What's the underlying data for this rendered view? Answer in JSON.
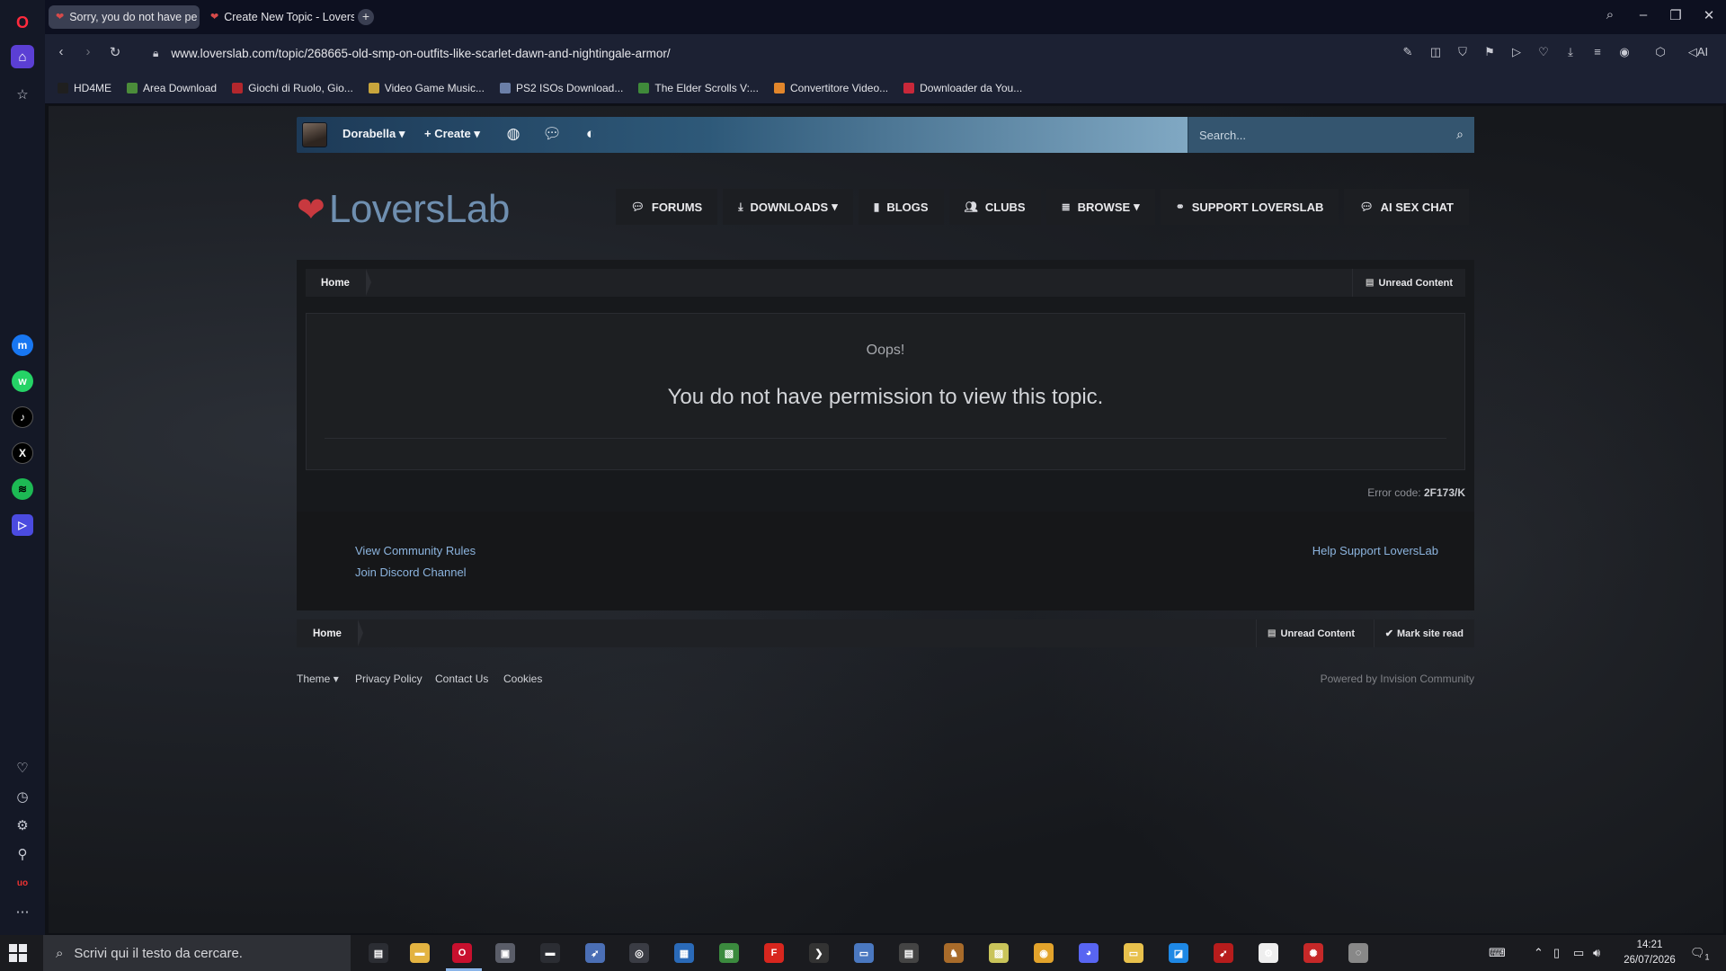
{
  "browser": {
    "tabs": [
      {
        "title": "Sorry, you do not have pe",
        "active": true
      },
      {
        "title": "Create New Topic - Lovers",
        "active": false
      }
    ],
    "url": "www.loverslab.com/topic/268665-old-smp-on-outfits-like-scarlet-dawn-and-nightingale-armor/",
    "bookmarks": [
      {
        "label": "HD4ME",
        "color": "#1f1f1f"
      },
      {
        "label": "Area Download",
        "color": "#4b8c3a"
      },
      {
        "label": "Giochi di Ruolo, Gio...",
        "color": "#b3272d"
      },
      {
        "label": "Video Game Music...",
        "color": "#c8a53c"
      },
      {
        "label": "PS2 ISOs Download...",
        "color": "#6b7fa8"
      },
      {
        "label": "The Elder Scrolls V:...",
        "color": "#3f8a3a"
      },
      {
        "label": "Convertitore Video...",
        "color": "#e2862b"
      },
      {
        "label": "Downloader da You...",
        "color": "#c8283a"
      }
    ],
    "address_icons": [
      "edit-icon",
      "camera-icon",
      "shield-icon",
      "vpn-icon",
      "play-icon",
      "heart-icon",
      "download-icon",
      "menu-icon",
      "profile-icon",
      "cube-icon"
    ],
    "ai_label": "AI"
  },
  "sidebar": {
    "top_icons": [
      "home-icon",
      "star-icon"
    ],
    "apps": [
      "messenger-icon",
      "whatsapp-icon",
      "tiktok-icon",
      "x-icon",
      "spotify-icon",
      "player-icon"
    ],
    "bottom_icons": [
      "heart-icon",
      "history-icon",
      "settings-icon",
      "lightbulb-icon",
      "ublock-icon",
      "more-icon"
    ]
  },
  "site": {
    "userbar": {
      "username": "Dorabella",
      "create": "Create",
      "search_placeholder": "Search..."
    },
    "logo": {
      "text": "LoversLab"
    },
    "nav": [
      {
        "label": "FORUMS",
        "icon": "chat-icon",
        "dropdown": false
      },
      {
        "label": "DOWNLOADS",
        "icon": "download-icon",
        "dropdown": true
      },
      {
        "label": "BLOGS",
        "icon": "book-icon",
        "dropdown": false
      },
      {
        "label": "CLUBS",
        "icon": "users-icon",
        "dropdown": false
      },
      {
        "label": "BROWSE",
        "icon": "list-icon",
        "dropdown": true
      },
      {
        "label": "SUPPORT LOVERSLAB",
        "icon": "handshake-icon",
        "dropdown": false
      },
      {
        "label": "AI SEX CHAT",
        "icon": "chat-icon",
        "dropdown": false
      }
    ],
    "breadcrumb": {
      "home": "Home",
      "unread": "Unread Content",
      "mark_read": "Mark site read"
    },
    "error": {
      "oops": "Oops!",
      "message": "You do not have permission to view this topic.",
      "code_label": "Error code:",
      "code": "2F173/K"
    },
    "footer_links": {
      "rules": "View Community Rules",
      "discord": "Join Discord Channel",
      "support": "Help Support LoversLab"
    },
    "footer": {
      "theme": "Theme",
      "privacy": "Privacy Policy",
      "contact": "Contact Us",
      "cookies": "Cookies",
      "powered": "Powered by Invision Community"
    }
  },
  "taskbar": {
    "search_placeholder": "Scrivi qui il testo da cercare.",
    "time": "14:21",
    "date": "26/07/2026",
    "notification_count": "1"
  }
}
